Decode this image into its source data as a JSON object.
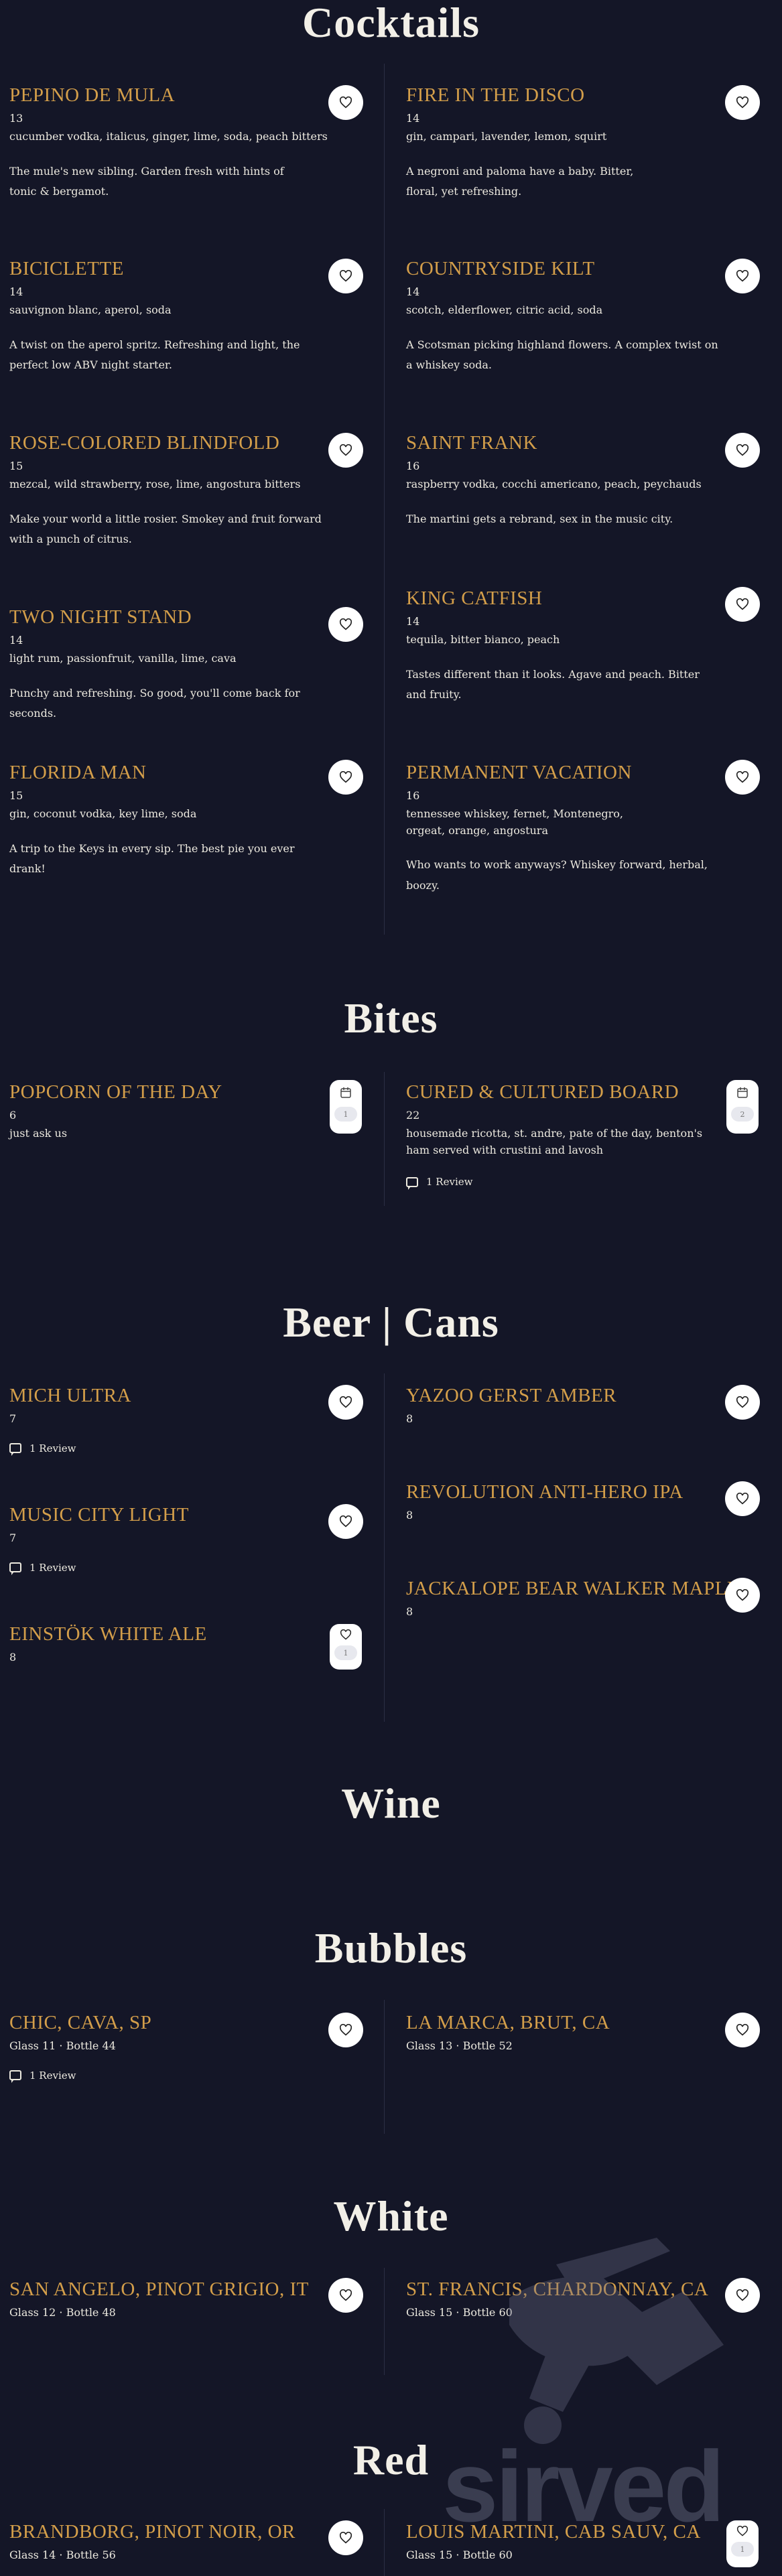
{
  "sections": {
    "cocktails": "Cocktails",
    "bites": "Bites",
    "beer": "Beer | Cans",
    "wine": "Wine",
    "bubbles": "Bubbles",
    "white": "White",
    "red": "Red"
  },
  "cocktails": [
    {
      "name": "PEPINO DE MULA",
      "price": "13",
      "ingredients": "cucumber vodka, italicus, ginger, lime, soda, peach bitters",
      "desc": "The mule's new sibling. Garden fresh with hints of tonic & bergamot."
    },
    {
      "name": "FIRE IN THE DISCO",
      "price": "14",
      "ingredients": "gin, campari, lavender, lemon, squirt",
      "desc": "A negroni and paloma have a baby. Bitter, floral, yet refreshing."
    },
    {
      "name": "BICICLETTE",
      "price": "14",
      "ingredients": "sauvignon blanc, aperol, soda",
      "desc": "A twist on the aperol spritz. Refreshing and light, the perfect low ABV night starter."
    },
    {
      "name": "COUNTRYSIDE KILT",
      "price": "14",
      "ingredients": "scotch, elderflower, citric acid, soda",
      "desc": "A Scotsman picking highland flowers. A complex twist on a whiskey soda."
    },
    {
      "name": "ROSE-COLORED BLINDFOLD",
      "price": "15",
      "ingredients": "mezcal, wild strawberry, rose, lime, angostura bitters",
      "desc": "Make your world a little rosier. Smokey and fruit forward with a punch of citrus."
    },
    {
      "name": "SAINT FRANK",
      "price": "16",
      "ingredients": "raspberry vodka, cocchi americano, peach, peychauds",
      "desc": "The martini gets a rebrand, sex in the music city."
    },
    {
      "name": "TWO NIGHT STAND",
      "price": "14",
      "ingredients": "light rum, passionfruit, vanilla, lime, cava",
      "desc": "Punchy and refreshing. So good, you'll come back for seconds."
    },
    {
      "name": "KING CATFISH",
      "price": "14",
      "ingredients": "tequila, bitter bianco, peach",
      "desc": "Tastes different than it looks. Agave and peach. Bitter and fruity."
    },
    {
      "name": "FLORIDA MAN",
      "price": "15",
      "ingredients": "gin, coconut vodka, key lime, soda",
      "desc": "A trip to the Keys in every sip. The best pie you ever drank!"
    },
    {
      "name": "PERMANENT VACATION",
      "price": "16",
      "ingredients": "tennessee whiskey, fernet, Montenegro, orgeat, orange, angostura",
      "desc": "Who wants to work anyways? Whiskey forward, herbal, boozy."
    }
  ],
  "bites": [
    {
      "name": "POPCORN OF THE DAY",
      "price": "6",
      "ingredients": "just ask us",
      "count": "1"
    },
    {
      "name": "CURED & CULTURED BOARD",
      "price": "22",
      "ingredients": "housemade ricotta, st. andre, pate of the day, benton's ham served with crustini and lavosh",
      "review": "1 Review",
      "count": "2"
    }
  ],
  "beer": [
    {
      "name": "MICH ULTRA",
      "price": "7",
      "review": "1 Review"
    },
    {
      "name": "YAZOO GERST AMBER",
      "price": "8"
    },
    {
      "name": "MUSIC CITY LIGHT",
      "price": "7",
      "review": "1 Review"
    },
    {
      "name": "REVOLUTION ANTI-HERO IPA",
      "price": "8"
    },
    {
      "name": "JACKALOPE BEAR WALKER MAPLE",
      "price": "8"
    },
    {
      "name": "EINSTÖK WHITE ALE",
      "price": "8",
      "count": "1"
    }
  ],
  "bubbles": [
    {
      "name": "CHIC, CAVA, SP",
      "price": "Glass 11 · Bottle 44",
      "review": "1 Review"
    },
    {
      "name": "LA MARCA, BRUT, CA",
      "price": "Glass 13 · Bottle 52"
    }
  ],
  "white": [
    {
      "name": "SAN ANGELO, PINOT GRIGIO, IT",
      "price": "Glass 12 · Bottle 48"
    },
    {
      "name": "ST. FRANCIS, CHARDONNAY, CA",
      "price": "Glass 15 · Bottle 60"
    }
  ],
  "red": [
    {
      "name": "BRANDBORG, PINOT NOIR, OR",
      "price": "Glass 14 · Bottle 56"
    },
    {
      "name": "LOUIS MARTINI, CAB SAUV, CA",
      "price": "Glass 15 · Bottle 60",
      "count": "1"
    }
  ],
  "watermark": "sirved",
  "icons": {
    "favorite": "heart-icon",
    "review": "comment-icon",
    "calendar": "calendar-icon"
  }
}
